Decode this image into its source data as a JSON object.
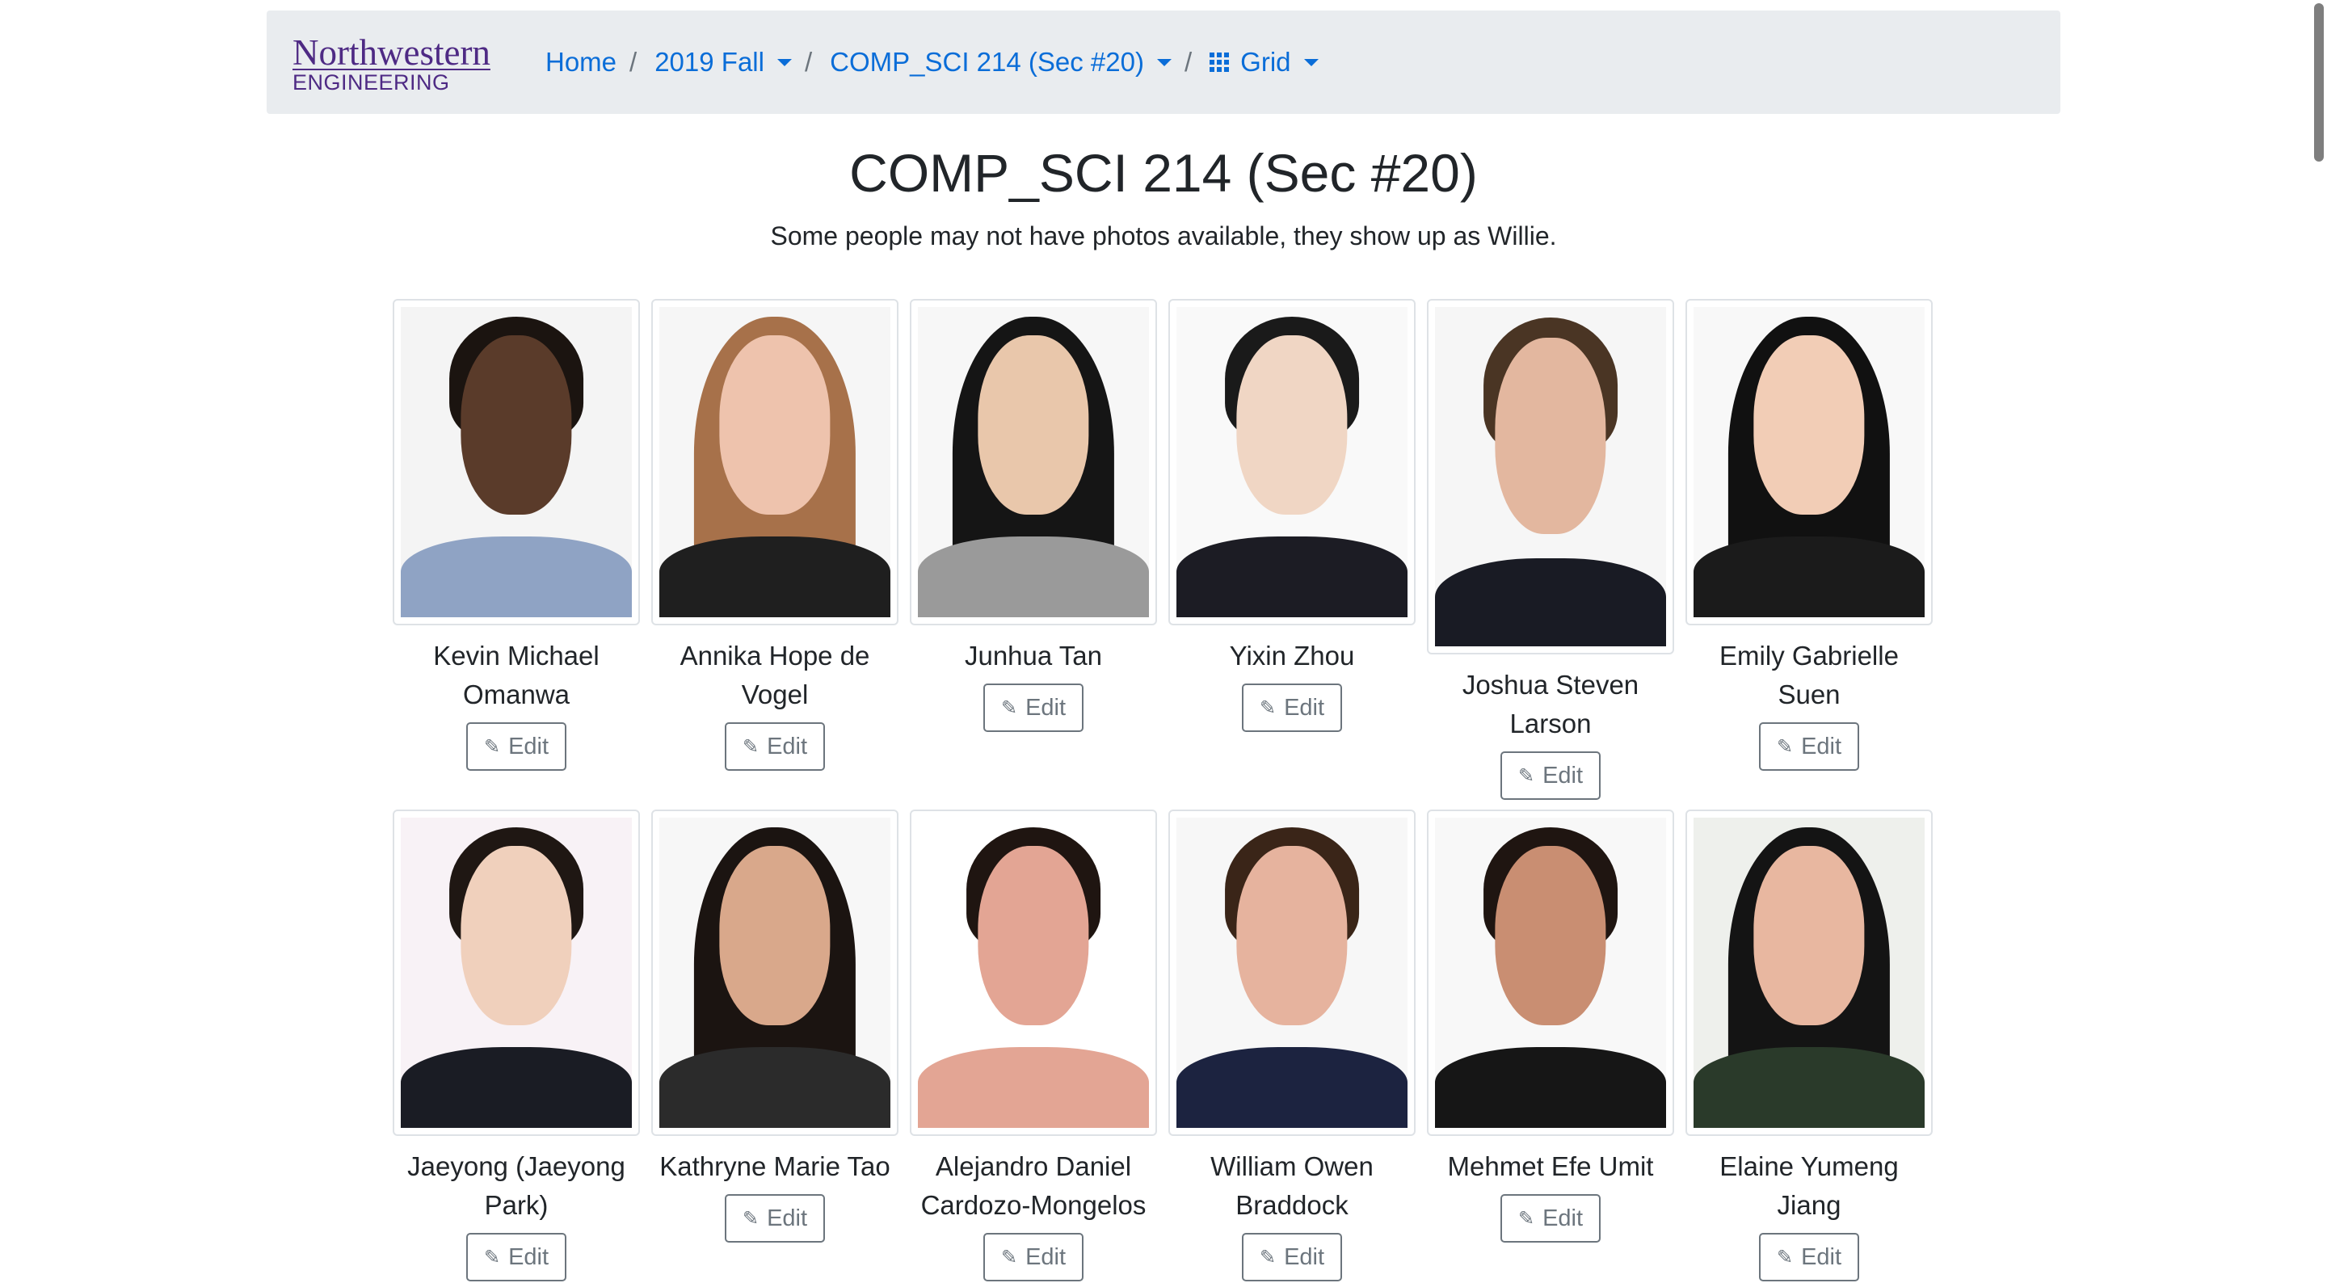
{
  "nav": {
    "logo_line1": "Northwestern",
    "logo_line2": "ENGINEERING",
    "home": "Home",
    "term": "2019 Fall",
    "course": "COMP_SCI 214 (Sec #20)",
    "view": "Grid",
    "separator": "/"
  },
  "page": {
    "title": "COMP_SCI 214 (Sec #20)",
    "subtitle": "Some people may not have photos available, they show up as Willie."
  },
  "edit_label": "Edit",
  "edit_icon": "pencil-icon",
  "people": [
    {
      "name": "Kevin Michael Omanwa"
    },
    {
      "name": "Annika Hope de Vogel"
    },
    {
      "name": "Junhua Tan"
    },
    {
      "name": "Yixin Zhou"
    },
    {
      "name": "Joshua Steven Larson"
    },
    {
      "name": "Emily Gabrielle Suen"
    },
    {
      "name": "Jaeyong (Jaeyong Park)"
    },
    {
      "name": "Kathryne Marie Tao"
    },
    {
      "name": "Alejandro Daniel Cardozo-Mongelos"
    },
    {
      "name": "William Owen Braddock"
    },
    {
      "name": "Mehmet Efe Umit"
    },
    {
      "name": "Elaine Yumeng Jiang"
    }
  ],
  "colors": {
    "brand_purple": "#4e2a84",
    "link_blue": "#0a6dd8",
    "nav_bg": "#e9ecef",
    "button_gray": "#6c757d"
  }
}
